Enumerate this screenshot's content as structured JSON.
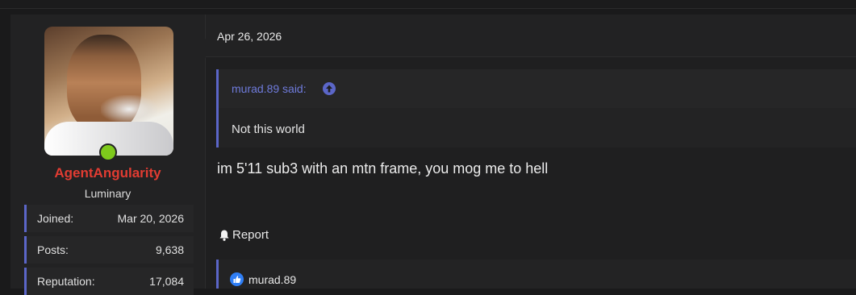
{
  "post": {
    "date": "Apr 26, 2026",
    "quote": {
      "author_label": "murad.89 said:",
      "text": "Not this world"
    },
    "message": "im 5'11 sub3 with an mtn frame, you mog me to hell",
    "report_label": "Report",
    "reactions": {
      "user": "murad.89",
      "icon": "like-icon"
    }
  },
  "user": {
    "name": "AgentAngularity",
    "title": "Luminary",
    "online": true,
    "stats": [
      {
        "label": "Joined:",
        "value": "Mar 20, 2026"
      },
      {
        "label": "Posts:",
        "value": "9,638"
      },
      {
        "label": "Reputation:",
        "value": "17,084"
      }
    ]
  },
  "colors": {
    "accent": "#5b66c8",
    "username": "#e23c32",
    "online": "#7ec91c",
    "like": "#2f7ef5"
  }
}
